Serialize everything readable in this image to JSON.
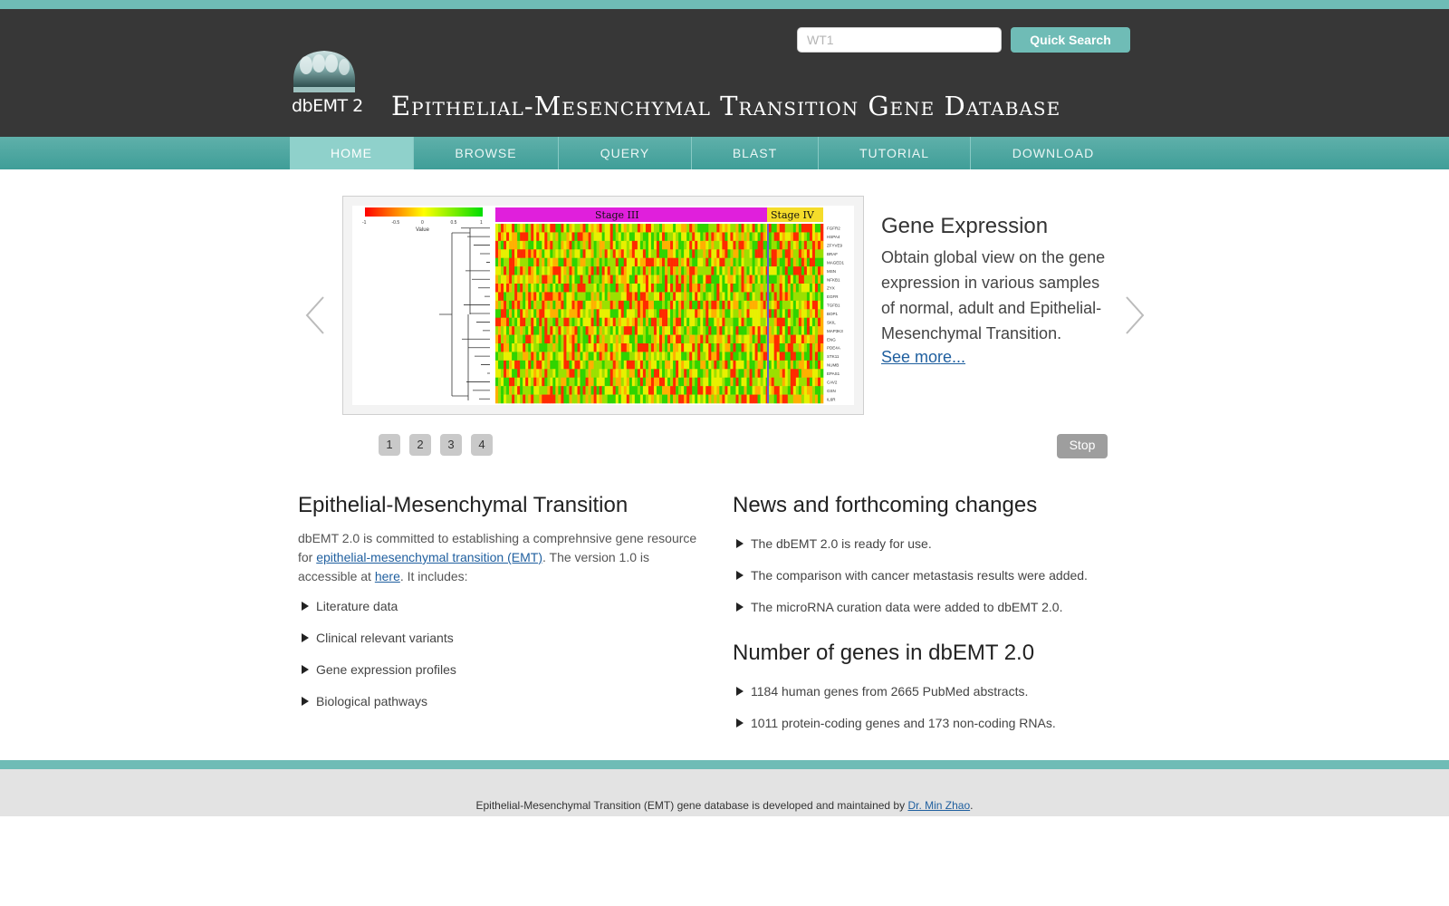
{
  "search": {
    "placeholder": "WT1",
    "button_label": "Quick Search"
  },
  "logo": {
    "text": "dbEMT 2"
  },
  "site_title": "Epithelial-Mesenchymal Transition Gene Database",
  "nav": [
    {
      "label": "HOME",
      "active": true
    },
    {
      "label": "BROWSE"
    },
    {
      "label": "QUERY"
    },
    {
      "label": "BLAST"
    },
    {
      "label": "TUTORIAL"
    },
    {
      "label": "DOWNLOAD"
    }
  ],
  "slider": {
    "heatmap": {
      "scale_labels": [
        "-1",
        "-0.5",
        "0",
        "0.5",
        "1"
      ],
      "scale_caption": "Value",
      "stage_labels": [
        "Stage III",
        "Stage IV"
      ],
      "genes": [
        "FGFR2",
        "HSPA4",
        "ZFYVE9",
        "BRAF",
        "MAGED1",
        "MSN",
        "NFKB1",
        "ZYX",
        "EGFR",
        "TGFB1",
        "BOP1",
        "SKIL",
        "MAP3K3",
        "ENG",
        "PDE4A",
        "STK11",
        "NUMB",
        "EPAS1",
        "CAV2",
        "GSN",
        "IL6R"
      ],
      "colors": {
        "stage3": "#e01fdc",
        "stage4": "#f5dc2a"
      }
    },
    "title": "Gene Expression",
    "description": "Obtain global view on the gene expression in various samples of normal, adult and Epithelial-Mesenchymal Transition.",
    "more_label": "See more...",
    "pager": [
      "1",
      "2",
      "3",
      "4"
    ],
    "stop_label": "Stop"
  },
  "emt": {
    "heading": "Epithelial-Mesenchymal Transition",
    "intro_1": "dbEMT 2.0 is committed to establishing a comprehnsive gene resource for ",
    "intro_link": "epithelial-mesenchymal transition (EMT)",
    "intro_2": ". The version 1.0 is accessible at ",
    "here_link": "here",
    "intro_3": ". It includes:",
    "items": [
      "Literature data",
      "Clinical relevant variants",
      "Gene expression profiles",
      "Biological pathways"
    ]
  },
  "news": {
    "heading": "News and forthcoming changes",
    "items": [
      "The dbEMT 2.0 is ready for use.",
      "The comparison with cancer metastasis results were added.",
      "The microRNA curation data were added to dbEMT 2.0."
    ]
  },
  "genes": {
    "heading": "Number of genes in dbEMT 2.0",
    "items": [
      "1184 human genes from 2665 PubMed abstracts.",
      "1011 protein-coding genes and 173 non-coding RNAs."
    ]
  },
  "footer": {
    "text": "Epithelial-Mesenchymal Transition (EMT) gene database is developed and maintained by ",
    "link": "Dr. Min Zhao",
    "end": "."
  },
  "colors": {
    "accent": "#6fbcb6",
    "header": "#373737",
    "link": "#1f5f9f"
  }
}
